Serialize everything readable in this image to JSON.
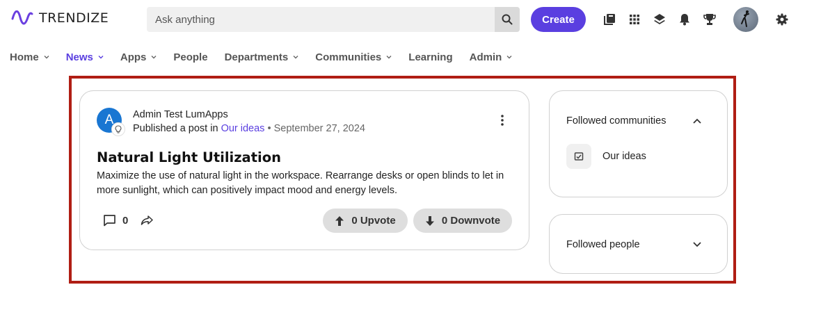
{
  "app": {
    "brand": "TRENDIZE",
    "accent_color": "#5a3fe0"
  },
  "header": {
    "search_placeholder": "Ask anything",
    "create_label": "Create",
    "icons": [
      "library-icon",
      "apps-grid-icon",
      "layers-icon",
      "bell-icon",
      "trophy-icon",
      "user-avatar",
      "gear-icon"
    ]
  },
  "nav": {
    "items": [
      {
        "label": "Home",
        "has_dropdown": true,
        "active": false
      },
      {
        "label": "News",
        "has_dropdown": true,
        "active": true
      },
      {
        "label": "Apps",
        "has_dropdown": true,
        "active": false
      },
      {
        "label": "People",
        "has_dropdown": false,
        "active": false
      },
      {
        "label": "Departments",
        "has_dropdown": true,
        "active": false
      },
      {
        "label": "Communities",
        "has_dropdown": true,
        "active": false
      },
      {
        "label": "Learning",
        "has_dropdown": false,
        "active": false
      },
      {
        "label": "Admin",
        "has_dropdown": true,
        "active": false
      }
    ]
  },
  "post": {
    "author_initial": "A",
    "author_name": "Admin Test LumApps",
    "published_prefix": "Published a post in",
    "community_link": "Our ideas",
    "separator": "•",
    "date": "September 27, 2024",
    "title": "Natural Light Utilization",
    "body": "Maximize the use of natural light in the workspace. Rearrange desks or open blinds to let in more sunlight, which can positively impact mood and energy levels.",
    "comment_count": "0",
    "upvote_label": "0 Upvote",
    "downvote_label": "0 Downvote"
  },
  "sidebar": {
    "communities_title": "Followed communities",
    "communities": [
      {
        "label": "Our ideas"
      }
    ],
    "people_title": "Followed people"
  },
  "highlight_color": "#b01e14"
}
